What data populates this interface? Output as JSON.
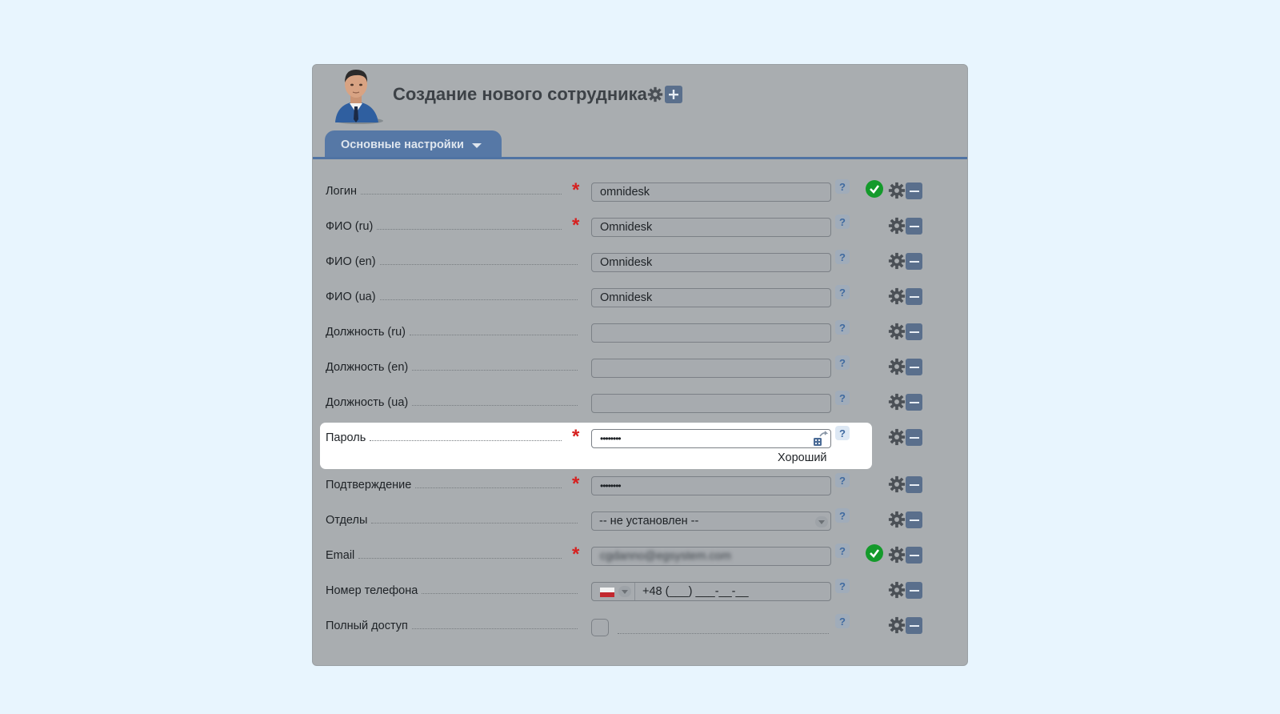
{
  "header": {
    "title": "Создание нового сотрудника"
  },
  "tabs": [
    {
      "label": "Основные настройки"
    }
  ],
  "fields": [
    {
      "label": "Логин",
      "value": "omnidesk",
      "required": true,
      "valid": true
    },
    {
      "label": "ФИО (ru)",
      "value": "Omnidesk",
      "required": true
    },
    {
      "label": "ФИО (en)",
      "value": "Omnidesk",
      "required": false
    },
    {
      "label": "ФИО (ua)",
      "value": "Omnidesk",
      "required": false
    },
    {
      "label": "Должность (ru)",
      "value": "",
      "required": false
    },
    {
      "label": "Должность (en)",
      "value": "",
      "required": false
    },
    {
      "label": "Должность (ua)",
      "value": "",
      "required": false
    },
    {
      "label": "Пароль",
      "value": "••••••••",
      "required": true,
      "strength": "Хороший"
    },
    {
      "label": "Подтверждение",
      "value": "••••••••",
      "required": true
    },
    {
      "label": "Отделы",
      "value": "-- не установлен --",
      "required": false
    },
    {
      "label": "Email",
      "value": "cgdanno@egsystem.com",
      "required": true,
      "valid": true
    },
    {
      "label": "Номер телефона",
      "value": "+48 (___) ___-__-__",
      "required": false
    },
    {
      "label": "Полный доступ",
      "value": "",
      "required": false
    }
  ],
  "help_symbol": "?",
  "colors": {
    "accent": "#5678a6",
    "required": "#d6201f",
    "valid": "#149a2b"
  }
}
